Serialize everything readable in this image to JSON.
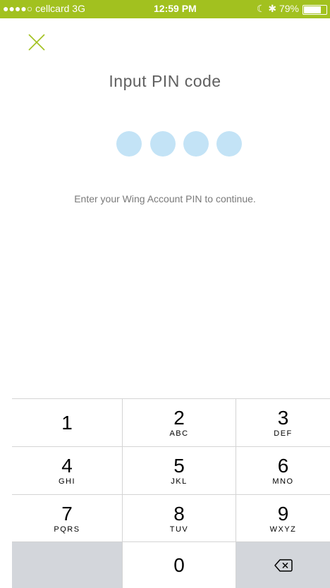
{
  "status_bar": {
    "carrier": "●●●●○ cellcard  3G",
    "time": "12:59 PM",
    "icons": "☾ ✱ 79%",
    "battery_percent": 79,
    "background": "#a2c11f"
  },
  "header": {
    "close_icon": "close-icon",
    "title": "Input PIN code"
  },
  "pin": {
    "length": 4,
    "dot_color": "#c3e3f6",
    "instruction": "Enter your Wing Account PIN to continue."
  },
  "keypad": {
    "keys": [
      {
        "digit": "1",
        "letters": ""
      },
      {
        "digit": "2",
        "letters": "ABC"
      },
      {
        "digit": "3",
        "letters": "DEF"
      },
      {
        "digit": "4",
        "letters": "GHI"
      },
      {
        "digit": "5",
        "letters": "JKL"
      },
      {
        "digit": "6",
        "letters": "MNO"
      },
      {
        "digit": "7",
        "letters": "PQRS"
      },
      {
        "digit": "8",
        "letters": "TUV"
      },
      {
        "digit": "9",
        "letters": "WXYZ"
      },
      {
        "digit": "0",
        "letters": ""
      }
    ],
    "delete_icon": "backspace-icon"
  }
}
